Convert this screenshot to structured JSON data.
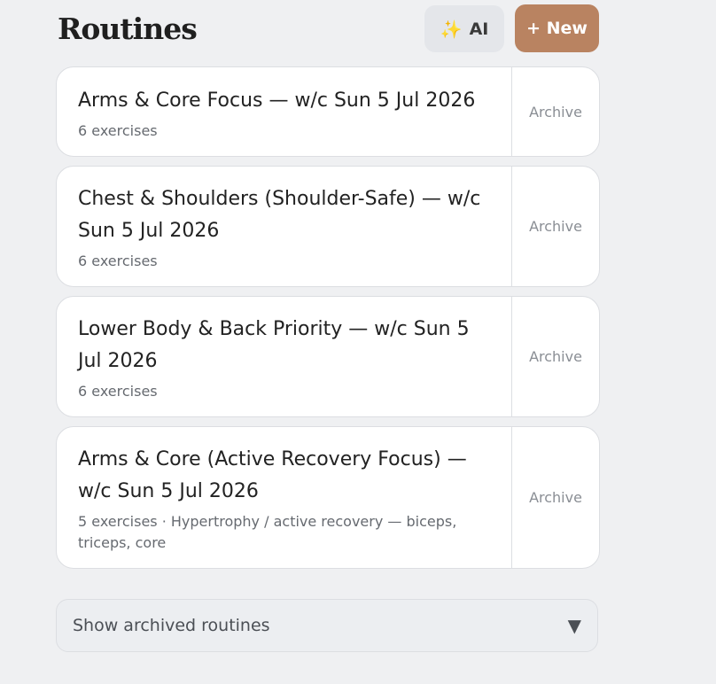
{
  "header": {
    "title": "Routines",
    "ai_icon": "✨",
    "ai_label": "AI",
    "new_label": "+ New"
  },
  "routines": [
    {
      "title": "Arms & Core Focus — w/c Sun 5 Jul 2026",
      "meta": "6 exercises",
      "archive_label": "Archive"
    },
    {
      "title": "Chest & Shoulders (Shoulder-Safe) — w/c Sun 5 Jul 2026",
      "meta": "6 exercises",
      "archive_label": "Archive"
    },
    {
      "title": "Lower Body & Back Priority — w/c Sun 5 Jul 2026",
      "meta": "6 exercises",
      "archive_label": "Archive"
    },
    {
      "title": "Arms & Core (Active Recovery Focus) — w/c Sun 5 Jul 2026",
      "meta": "5 exercises · Hypertrophy / active recovery — biceps, triceps, core",
      "archive_label": "Archive"
    }
  ],
  "archived_toggle": {
    "label": "Show archived routines",
    "chevron_icon": "▼"
  },
  "colors": {
    "background": "#eff0f2",
    "accent": "#b98361",
    "card": "#ffffff"
  }
}
